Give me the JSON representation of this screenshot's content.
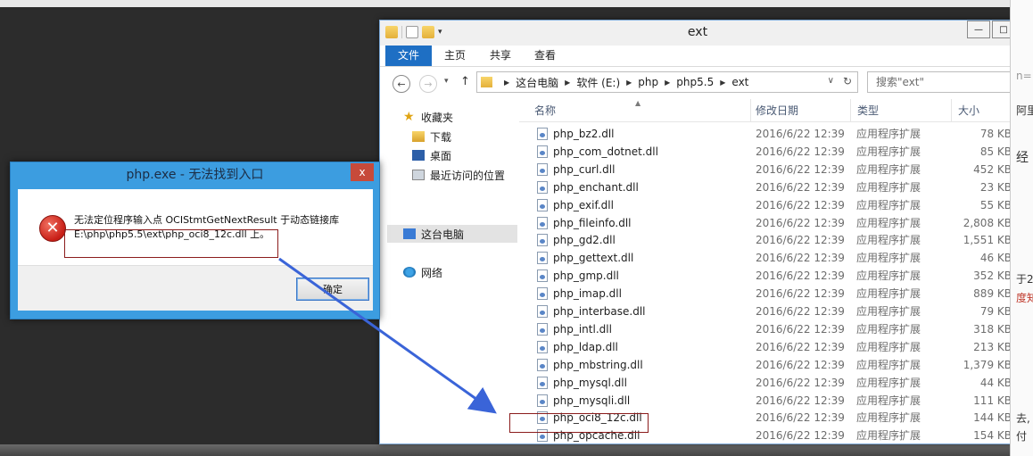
{
  "explorer": {
    "title": "ext",
    "ribbon_tabs": [
      "文件",
      "主页",
      "共享",
      "查看"
    ],
    "breadcrumb": [
      "这台电脑",
      "软件 (E:)",
      "php",
      "php5.5",
      "ext"
    ],
    "search_placeholder": "搜索\"ext\"",
    "nav": {
      "favorites": "收藏夹",
      "downloads": "下载",
      "desktop": "桌面",
      "recent": "最近访问的位置",
      "this_pc": "这台电脑",
      "network": "网络"
    },
    "columns": {
      "name": "名称",
      "date": "修改日期",
      "type": "类型",
      "size": "大小"
    },
    "files": [
      {
        "name": "php_bz2.dll",
        "date": "2016/6/22 12:39",
        "type": "应用程序扩展",
        "size": "78 KB"
      },
      {
        "name": "php_com_dotnet.dll",
        "date": "2016/6/22 12:39",
        "type": "应用程序扩展",
        "size": "85 KB"
      },
      {
        "name": "php_curl.dll",
        "date": "2016/6/22 12:39",
        "type": "应用程序扩展",
        "size": "452 KB"
      },
      {
        "name": "php_enchant.dll",
        "date": "2016/6/22 12:39",
        "type": "应用程序扩展",
        "size": "23 KB"
      },
      {
        "name": "php_exif.dll",
        "date": "2016/6/22 12:39",
        "type": "应用程序扩展",
        "size": "55 KB"
      },
      {
        "name": "php_fileinfo.dll",
        "date": "2016/6/22 12:39",
        "type": "应用程序扩展",
        "size": "2,808 KB"
      },
      {
        "name": "php_gd2.dll",
        "date": "2016/6/22 12:39",
        "type": "应用程序扩展",
        "size": "1,551 KB"
      },
      {
        "name": "php_gettext.dll",
        "date": "2016/6/22 12:39",
        "type": "应用程序扩展",
        "size": "46 KB"
      },
      {
        "name": "php_gmp.dll",
        "date": "2016/6/22 12:39",
        "type": "应用程序扩展",
        "size": "352 KB"
      },
      {
        "name": "php_imap.dll",
        "date": "2016/6/22 12:39",
        "type": "应用程序扩展",
        "size": "889 KB"
      },
      {
        "name": "php_interbase.dll",
        "date": "2016/6/22 12:39",
        "type": "应用程序扩展",
        "size": "79 KB"
      },
      {
        "name": "php_intl.dll",
        "date": "2016/6/22 12:39",
        "type": "应用程序扩展",
        "size": "318 KB"
      },
      {
        "name": "php_ldap.dll",
        "date": "2016/6/22 12:39",
        "type": "应用程序扩展",
        "size": "213 KB"
      },
      {
        "name": "php_mbstring.dll",
        "date": "2016/6/22 12:39",
        "type": "应用程序扩展",
        "size": "1,379 KB"
      },
      {
        "name": "php_mysql.dll",
        "date": "2016/6/22 12:39",
        "type": "应用程序扩展",
        "size": "44 KB"
      },
      {
        "name": "php_mysqli.dll",
        "date": "2016/6/22 12:39",
        "type": "应用程序扩展",
        "size": "111 KB"
      },
      {
        "name": "php_oci8_12c.dll",
        "date": "2016/6/22 12:39",
        "type": "应用程序扩展",
        "size": "144 KB"
      },
      {
        "name": "php_opcache.dll",
        "date": "2016/6/22 12:39",
        "type": "应用程序扩展",
        "size": "154 KB"
      }
    ]
  },
  "dialog": {
    "title": "php.exe - 无法找到入口",
    "close": "x",
    "message_line1": "无法定位程序输入点 OCIStmtGetNextResult 于动态链接库",
    "message_line2": "E:\\php\\php5.5\\ext\\php_oci8_12c.dll 上。",
    "ok_label": "确定"
  },
  "right_strip": {
    "t1": "n=",
    "t2": "阿里",
    "t3": "经",
    "t4": "于2",
    "t5": "度知",
    "t6": "去,",
    "t7": "付"
  },
  "colors": {
    "accent": "#1e6fc4",
    "dialog_frame": "#3c9de0",
    "annotation_box": "#8b1c1c",
    "annotation_arrow": "#3a64d8"
  }
}
